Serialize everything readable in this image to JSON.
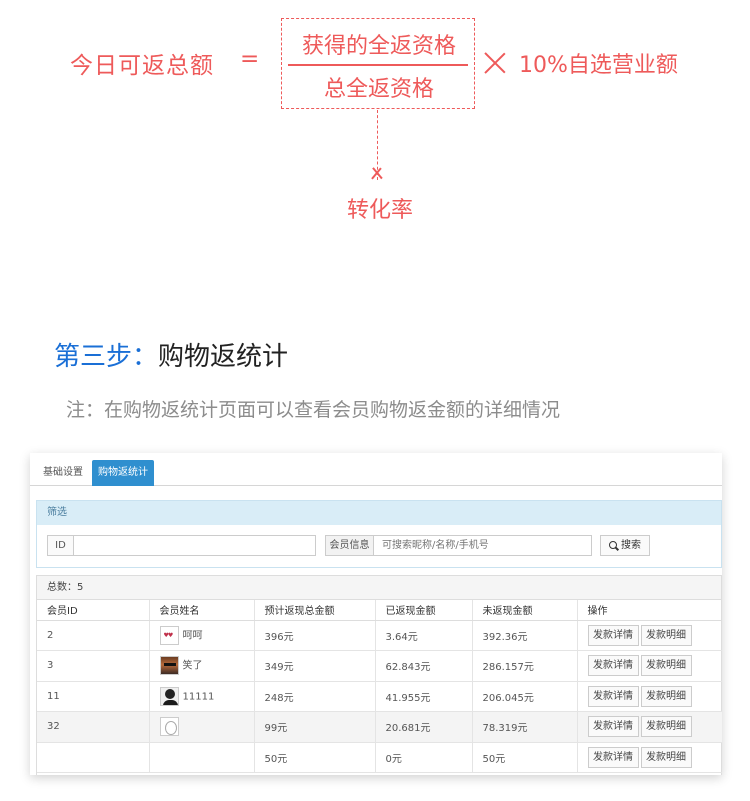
{
  "formula": {
    "left": "今日可返总额",
    "equals": "=",
    "numerator": "获得的全返资格",
    "denominator": "总全返资格",
    "right": "10%自选营业额",
    "conversion_label": "转化率",
    "accent_color": "#ee5a5a"
  },
  "step": {
    "number": "第三步：",
    "title": "购物返统计",
    "note": "注：在购物返统计页面可以查看会员购物返金额的详细情况",
    "number_color": "#1a6fd6"
  },
  "screenshot": {
    "tabs": [
      {
        "label": "基础设置",
        "active": false
      },
      {
        "label": "购物返统计",
        "active": true
      }
    ],
    "filter": {
      "title": "筛选",
      "id_label": "ID",
      "id_value": "",
      "member_label": "会员信息",
      "member_placeholder": "可搜索昵称/名称/手机号",
      "search_label": "搜索"
    },
    "total_label": "总数：5",
    "columns": [
      "会员ID",
      "会员姓名",
      "预计返现总金额",
      "已返现金额",
      "未返现金额",
      "操作"
    ],
    "rows": [
      {
        "id": "2",
        "name": "呵呵",
        "avatar": "hearts-avatar",
        "expected": "396元",
        "returned": "3.64元",
        "pending": "392.36元"
      },
      {
        "id": "3",
        "name": "笑了",
        "avatar": "photo-avatar",
        "expected": "349元",
        "returned": "62.843元",
        "pending": "286.157元"
      },
      {
        "id": "11",
        "name": "11111",
        "avatar": "person-avatar",
        "expected": "248元",
        "returned": "41.955元",
        "pending": "206.045元"
      },
      {
        "id": "32",
        "name": "",
        "avatar": "sketch-avatar",
        "expected": "99元",
        "returned": "20.681元",
        "pending": "78.319元"
      },
      {
        "id": "",
        "name": "",
        "avatar": "",
        "expected": "50元",
        "returned": "0元",
        "pending": "50元"
      }
    ],
    "action_detail": "发款详情",
    "action_breakdown": "发款明细",
    "active_tab_color": "#2f8fcf"
  }
}
